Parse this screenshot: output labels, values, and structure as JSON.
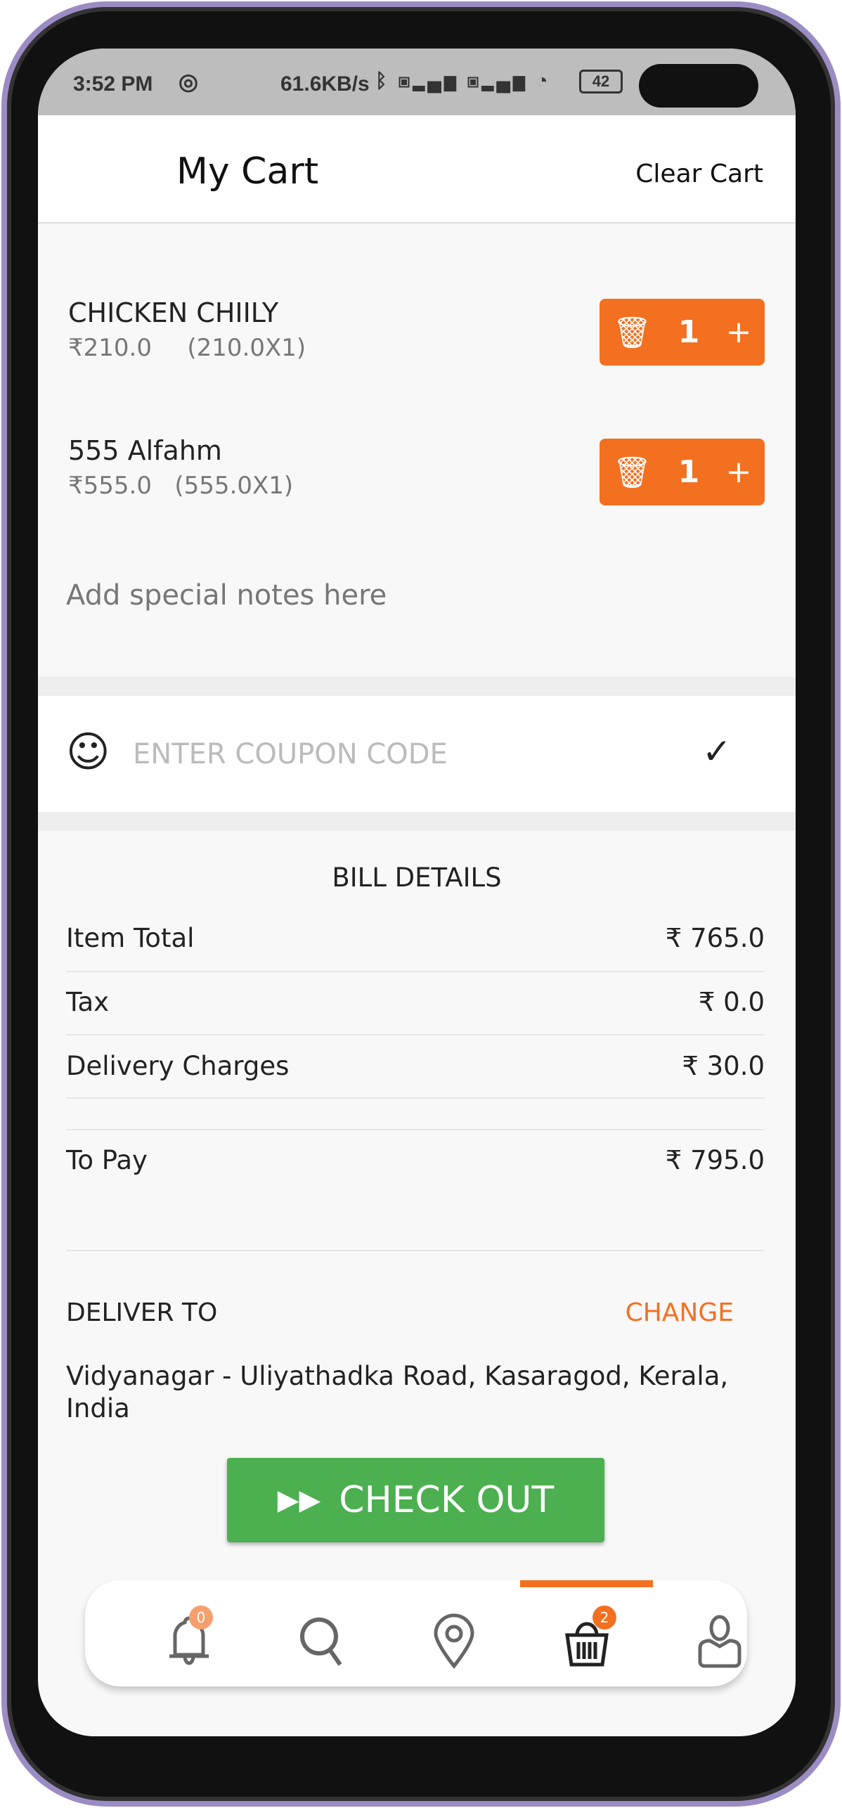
{
  "status_bar": {
    "time": "3:52 PM",
    "speed": "61.6KB/s",
    "battery": "42"
  },
  "header": {
    "title": "My Cart",
    "clear_label": "Clear Cart"
  },
  "cart": {
    "items": [
      {
        "name": "CHICKEN CHIILY",
        "price": "₹210.0",
        "calc": "(210.0X1)",
        "qty": "1"
      },
      {
        "name": "555 Alfahm",
        "price": "₹555.0",
        "calc": "(555.0X1)",
        "qty": "1"
      }
    ],
    "notes_placeholder": "Add special notes here"
  },
  "coupon": {
    "placeholder": "ENTER COUPON CODE"
  },
  "bill": {
    "title": "BILL DETAILS",
    "rows": [
      {
        "label": "Item Total",
        "value": "₹ 765.0"
      },
      {
        "label": "Tax",
        "value": "₹ 0.0"
      },
      {
        "label": "Delivery Charges",
        "value": "₹ 30.0"
      }
    ],
    "to_pay_label": "To Pay",
    "to_pay_value": "₹ 795.0"
  },
  "delivery": {
    "label": "DELIVER TO",
    "change_label": "CHANGE",
    "address": "Vidyanagar - Uliyathadka Road, Kasaragod, Kerala, India"
  },
  "checkout": {
    "label": "CHECK OUT"
  },
  "bottom_nav": {
    "notifications_badge": "0",
    "cart_badge": "2",
    "active": "cart"
  },
  "colors": {
    "accent": "#f37021",
    "checkout": "#4caf50"
  }
}
